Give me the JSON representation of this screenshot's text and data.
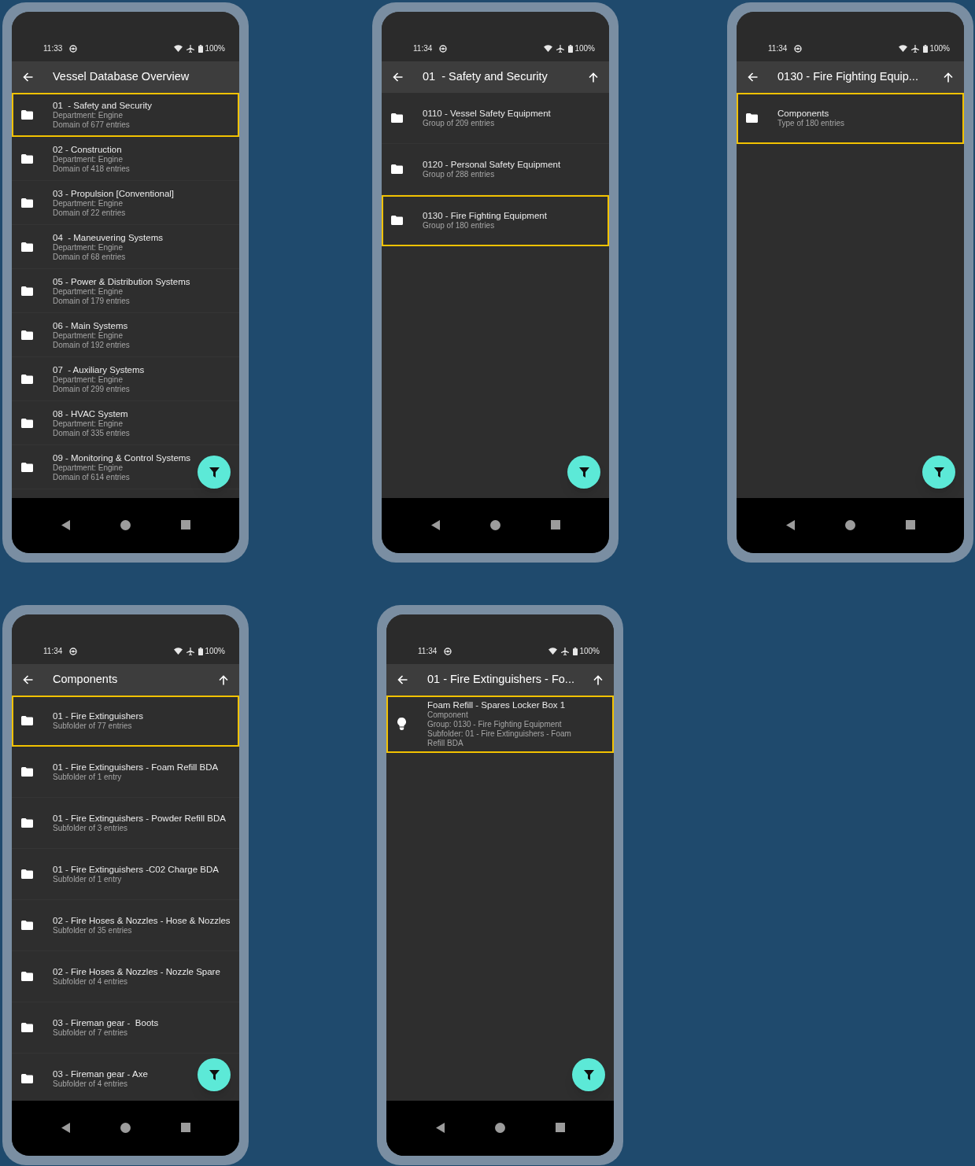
{
  "phones": [
    {
      "status": {
        "time": "11:33",
        "battery": "100%"
      },
      "app_bar": {
        "title": "Vessel Database Overview",
        "up_button": false
      },
      "items": [
        {
          "kind": "folder",
          "title": "01  - Safety and Security",
          "lines": [
            "Department: Engine",
            "Domain of 677 entries"
          ],
          "selected": true
        },
        {
          "kind": "folder",
          "title": "02 - Construction",
          "lines": [
            "Department: Engine",
            "Domain of 418 entries"
          ],
          "selected": false
        },
        {
          "kind": "folder",
          "title": "03 - Propulsion [Conventional]",
          "lines": [
            "Department: Engine",
            "Domain of 22 entries"
          ],
          "selected": false
        },
        {
          "kind": "folder",
          "title": "04  - Maneuvering Systems",
          "lines": [
            "Department: Engine",
            "Domain of 68 entries"
          ],
          "selected": false
        },
        {
          "kind": "folder",
          "title": "05 - Power & Distribution Systems",
          "lines": [
            "Department: Engine",
            "Domain of 179 entries"
          ],
          "selected": false
        },
        {
          "kind": "folder",
          "title": "06 - Main Systems",
          "lines": [
            "Department: Engine",
            "Domain of 192 entries"
          ],
          "selected": false
        },
        {
          "kind": "folder",
          "title": "07  - Auxiliary Systems",
          "lines": [
            "Department: Engine",
            "Domain of 299 entries"
          ],
          "selected": false
        },
        {
          "kind": "folder",
          "title": "08 - HVAC System",
          "lines": [
            "Department: Engine",
            "Domain of 335 entries"
          ],
          "selected": false
        },
        {
          "kind": "folder",
          "title": "09 - Monitoring & Control Systems",
          "lines": [
            "Department: Engine",
            "Domain of 614 entries"
          ],
          "selected": false
        }
      ]
    },
    {
      "status": {
        "time": "11:34",
        "battery": "100%"
      },
      "app_bar": {
        "title": "01  - Safety and Security",
        "up_button": true
      },
      "items": [
        {
          "kind": "folder",
          "title": "0110 - Vessel Safety Equipment",
          "lines": [
            "Group of 209 entries"
          ],
          "selected": false
        },
        {
          "kind": "folder",
          "title": "0120 - Personal Safety Equipment",
          "lines": [
            "Group of 288 entries"
          ],
          "selected": false
        },
        {
          "kind": "folder",
          "title": "0130 - Fire Fighting Equipment",
          "lines": [
            "Group of 180 entries"
          ],
          "selected": true
        }
      ]
    },
    {
      "status": {
        "time": "11:34",
        "battery": "100%"
      },
      "app_bar": {
        "title": "0130 - Fire Fighting Equip...",
        "up_button": true
      },
      "items": [
        {
          "kind": "folder",
          "title": "Components",
          "lines": [
            "Type of 180 entries"
          ],
          "selected": true
        }
      ]
    },
    {
      "status": {
        "time": "11:34",
        "battery": "100%"
      },
      "app_bar": {
        "title": "Components",
        "up_button": true
      },
      "items": [
        {
          "kind": "folder",
          "title": "01 - Fire Extinguishers",
          "lines": [
            "Subfolder of 77 entries"
          ],
          "selected": true
        },
        {
          "kind": "folder",
          "title": "01 - Fire Extinguishers - Foam Refill BDA",
          "lines": [
            "Subfolder of 1 entry"
          ],
          "selected": false
        },
        {
          "kind": "folder",
          "title": "01 - Fire Extinguishers - Powder Refill BDA",
          "lines": [
            "Subfolder of 3 entries"
          ],
          "selected": false
        },
        {
          "kind": "folder",
          "title": "01 - Fire Extinguishers -C02 Charge BDA",
          "lines": [
            "Subfolder of 1 entry"
          ],
          "selected": false
        },
        {
          "kind": "folder",
          "title": "02 - Fire Hoses & Nozzles - Hose & Nozzles",
          "lines": [
            "Subfolder of 35 entries"
          ],
          "selected": false
        },
        {
          "kind": "folder",
          "title": "02 - Fire Hoses & Nozzles - Nozzle Spare",
          "lines": [
            "Subfolder of 4 entries"
          ],
          "selected": false
        },
        {
          "kind": "folder",
          "title": "03 - Fireman gear -  Boots",
          "lines": [
            "Subfolder of 7 entries"
          ],
          "selected": false
        },
        {
          "kind": "folder",
          "title": "03 - Fireman gear - Axe",
          "lines": [
            "Subfolder of 4 entries"
          ],
          "selected": false
        }
      ]
    },
    {
      "status": {
        "time": "11:34",
        "battery": "100%"
      },
      "app_bar": {
        "title": "01 - Fire Extinguishers - Fo...",
        "up_button": true
      },
      "items": [
        {
          "kind": "component",
          "title": "Foam Refill - Spares Locker Box 1",
          "lines": [
            "Component",
            "Group: 0130 - Fire Fighting Equipment",
            "Subfolder: 01 - Fire Extinguishers - Foam Refill BDA"
          ],
          "selected": true
        }
      ]
    }
  ]
}
